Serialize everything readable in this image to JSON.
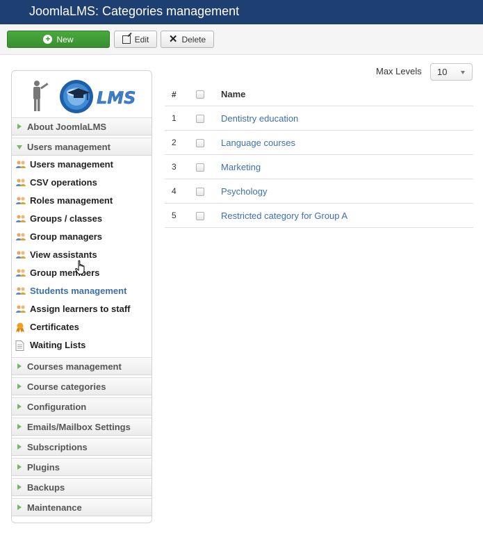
{
  "header": {
    "title": "JoomlaLMS: Categories management"
  },
  "toolbar": {
    "new_label": "New",
    "edit_label": "Edit",
    "delete_label": "Delete"
  },
  "sidebar": {
    "logo_text": "LMS",
    "sections_top": [
      {
        "label": "About JoomlaLMS",
        "expanded": false
      },
      {
        "label": "Users management",
        "expanded": true
      }
    ],
    "items": [
      {
        "label": "Users management",
        "icon": "users-icon"
      },
      {
        "label": "CSV operations",
        "icon": "users-icon"
      },
      {
        "label": "Roles management",
        "icon": "users-icon"
      },
      {
        "label": "Groups / classes",
        "icon": "users-icon"
      },
      {
        "label": "Group managers",
        "icon": "users-icon"
      },
      {
        "label": "View assistants",
        "icon": "users-icon"
      },
      {
        "label": "Group members",
        "icon": "users-icon"
      },
      {
        "label": "Students management",
        "icon": "users-icon",
        "active": true
      },
      {
        "label": "Assign learners to staff",
        "icon": "users-icon"
      },
      {
        "label": "Certificates",
        "icon": "certificate-icon"
      },
      {
        "label": "Waiting Lists",
        "icon": "document-icon"
      }
    ],
    "sections_bottom": [
      {
        "label": "Courses management"
      },
      {
        "label": "Course categories"
      },
      {
        "label": "Configuration"
      },
      {
        "label": "Emails/Mailbox Settings"
      },
      {
        "label": "Subscriptions"
      },
      {
        "label": "Plugins"
      },
      {
        "label": "Backups"
      },
      {
        "label": "Maintenance"
      }
    ]
  },
  "filter": {
    "max_levels_label": "Max Levels",
    "max_levels_value": "10"
  },
  "table": {
    "headers": {
      "num": "#",
      "name": "Name"
    },
    "rows": [
      {
        "num": "1",
        "name": "Dentistry education"
      },
      {
        "num": "2",
        "name": "Language courses"
      },
      {
        "num": "3",
        "name": "Marketing"
      },
      {
        "num": "4",
        "name": "Psychology"
      },
      {
        "num": "5",
        "name": "Restricted category for Group A"
      }
    ]
  },
  "colors": {
    "header_bg": "#1d3f72",
    "new_button": "#3a8f31",
    "link": "#3d6fb0",
    "tree_arrow": "#7cb36a"
  }
}
